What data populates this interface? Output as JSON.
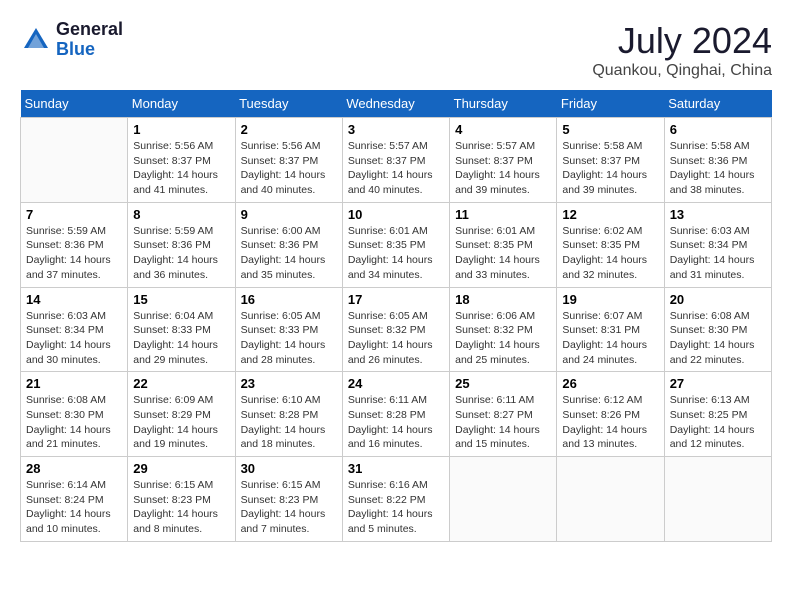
{
  "header": {
    "logo_general": "General",
    "logo_blue": "Blue",
    "month_year": "July 2024",
    "location": "Quankou, Qinghai, China"
  },
  "weekdays": [
    "Sunday",
    "Monday",
    "Tuesday",
    "Wednesday",
    "Thursday",
    "Friday",
    "Saturday"
  ],
  "weeks": [
    [
      {
        "num": "",
        "sunrise": "",
        "sunset": "",
        "daylight": ""
      },
      {
        "num": "1",
        "sunrise": "Sunrise: 5:56 AM",
        "sunset": "Sunset: 8:37 PM",
        "daylight": "Daylight: 14 hours and 41 minutes."
      },
      {
        "num": "2",
        "sunrise": "Sunrise: 5:56 AM",
        "sunset": "Sunset: 8:37 PM",
        "daylight": "Daylight: 14 hours and 40 minutes."
      },
      {
        "num": "3",
        "sunrise": "Sunrise: 5:57 AM",
        "sunset": "Sunset: 8:37 PM",
        "daylight": "Daylight: 14 hours and 40 minutes."
      },
      {
        "num": "4",
        "sunrise": "Sunrise: 5:57 AM",
        "sunset": "Sunset: 8:37 PM",
        "daylight": "Daylight: 14 hours and 39 minutes."
      },
      {
        "num": "5",
        "sunrise": "Sunrise: 5:58 AM",
        "sunset": "Sunset: 8:37 PM",
        "daylight": "Daylight: 14 hours and 39 minutes."
      },
      {
        "num": "6",
        "sunrise": "Sunrise: 5:58 AM",
        "sunset": "Sunset: 8:36 PM",
        "daylight": "Daylight: 14 hours and 38 minutes."
      }
    ],
    [
      {
        "num": "7",
        "sunrise": "Sunrise: 5:59 AM",
        "sunset": "Sunset: 8:36 PM",
        "daylight": "Daylight: 14 hours and 37 minutes."
      },
      {
        "num": "8",
        "sunrise": "Sunrise: 5:59 AM",
        "sunset": "Sunset: 8:36 PM",
        "daylight": "Daylight: 14 hours and 36 minutes."
      },
      {
        "num": "9",
        "sunrise": "Sunrise: 6:00 AM",
        "sunset": "Sunset: 8:36 PM",
        "daylight": "Daylight: 14 hours and 35 minutes."
      },
      {
        "num": "10",
        "sunrise": "Sunrise: 6:01 AM",
        "sunset": "Sunset: 8:35 PM",
        "daylight": "Daylight: 14 hours and 34 minutes."
      },
      {
        "num": "11",
        "sunrise": "Sunrise: 6:01 AM",
        "sunset": "Sunset: 8:35 PM",
        "daylight": "Daylight: 14 hours and 33 minutes."
      },
      {
        "num": "12",
        "sunrise": "Sunrise: 6:02 AM",
        "sunset": "Sunset: 8:35 PM",
        "daylight": "Daylight: 14 hours and 32 minutes."
      },
      {
        "num": "13",
        "sunrise": "Sunrise: 6:03 AM",
        "sunset": "Sunset: 8:34 PM",
        "daylight": "Daylight: 14 hours and 31 minutes."
      }
    ],
    [
      {
        "num": "14",
        "sunrise": "Sunrise: 6:03 AM",
        "sunset": "Sunset: 8:34 PM",
        "daylight": "Daylight: 14 hours and 30 minutes."
      },
      {
        "num": "15",
        "sunrise": "Sunrise: 6:04 AM",
        "sunset": "Sunset: 8:33 PM",
        "daylight": "Daylight: 14 hours and 29 minutes."
      },
      {
        "num": "16",
        "sunrise": "Sunrise: 6:05 AM",
        "sunset": "Sunset: 8:33 PM",
        "daylight": "Daylight: 14 hours and 28 minutes."
      },
      {
        "num": "17",
        "sunrise": "Sunrise: 6:05 AM",
        "sunset": "Sunset: 8:32 PM",
        "daylight": "Daylight: 14 hours and 26 minutes."
      },
      {
        "num": "18",
        "sunrise": "Sunrise: 6:06 AM",
        "sunset": "Sunset: 8:32 PM",
        "daylight": "Daylight: 14 hours and 25 minutes."
      },
      {
        "num": "19",
        "sunrise": "Sunrise: 6:07 AM",
        "sunset": "Sunset: 8:31 PM",
        "daylight": "Daylight: 14 hours and 24 minutes."
      },
      {
        "num": "20",
        "sunrise": "Sunrise: 6:08 AM",
        "sunset": "Sunset: 8:30 PM",
        "daylight": "Daylight: 14 hours and 22 minutes."
      }
    ],
    [
      {
        "num": "21",
        "sunrise": "Sunrise: 6:08 AM",
        "sunset": "Sunset: 8:30 PM",
        "daylight": "Daylight: 14 hours and 21 minutes."
      },
      {
        "num": "22",
        "sunrise": "Sunrise: 6:09 AM",
        "sunset": "Sunset: 8:29 PM",
        "daylight": "Daylight: 14 hours and 19 minutes."
      },
      {
        "num": "23",
        "sunrise": "Sunrise: 6:10 AM",
        "sunset": "Sunset: 8:28 PM",
        "daylight": "Daylight: 14 hours and 18 minutes."
      },
      {
        "num": "24",
        "sunrise": "Sunrise: 6:11 AM",
        "sunset": "Sunset: 8:28 PM",
        "daylight": "Daylight: 14 hours and 16 minutes."
      },
      {
        "num": "25",
        "sunrise": "Sunrise: 6:11 AM",
        "sunset": "Sunset: 8:27 PM",
        "daylight": "Daylight: 14 hours and 15 minutes."
      },
      {
        "num": "26",
        "sunrise": "Sunrise: 6:12 AM",
        "sunset": "Sunset: 8:26 PM",
        "daylight": "Daylight: 14 hours and 13 minutes."
      },
      {
        "num": "27",
        "sunrise": "Sunrise: 6:13 AM",
        "sunset": "Sunset: 8:25 PM",
        "daylight": "Daylight: 14 hours and 12 minutes."
      }
    ],
    [
      {
        "num": "28",
        "sunrise": "Sunrise: 6:14 AM",
        "sunset": "Sunset: 8:24 PM",
        "daylight": "Daylight: 14 hours and 10 minutes."
      },
      {
        "num": "29",
        "sunrise": "Sunrise: 6:15 AM",
        "sunset": "Sunset: 8:23 PM",
        "daylight": "Daylight: 14 hours and 8 minutes."
      },
      {
        "num": "30",
        "sunrise": "Sunrise: 6:15 AM",
        "sunset": "Sunset: 8:23 PM",
        "daylight": "Daylight: 14 hours and 7 minutes."
      },
      {
        "num": "31",
        "sunrise": "Sunrise: 6:16 AM",
        "sunset": "Sunset: 8:22 PM",
        "daylight": "Daylight: 14 hours and 5 minutes."
      },
      {
        "num": "",
        "sunrise": "",
        "sunset": "",
        "daylight": ""
      },
      {
        "num": "",
        "sunrise": "",
        "sunset": "",
        "daylight": ""
      },
      {
        "num": "",
        "sunrise": "",
        "sunset": "",
        "daylight": ""
      }
    ]
  ]
}
